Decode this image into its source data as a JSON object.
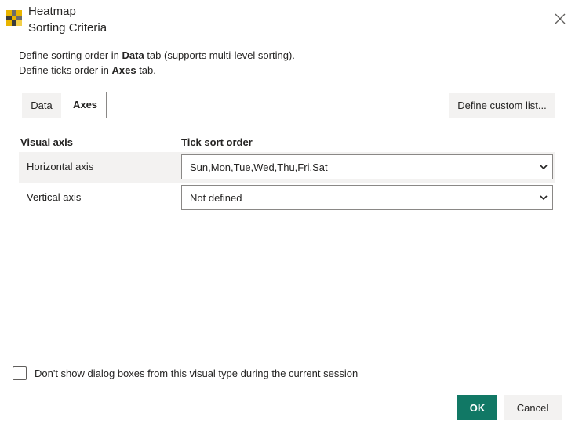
{
  "header": {
    "title": "Heatmap",
    "subtitle": "Sorting Criteria",
    "app_icon": "heatmap-icon",
    "close_icon": "close-icon"
  },
  "instructions": {
    "line1_prefix": "Define sorting order in ",
    "line1_bold": "Data",
    "line1_suffix": " tab (supports multi-level sorting).",
    "line2_prefix": "Define ticks order in ",
    "line2_bold": "Axes",
    "line2_suffix": " tab."
  },
  "tabs": [
    {
      "label": "Data",
      "active": false
    },
    {
      "label": "Axes",
      "active": true
    }
  ],
  "custom_list_button": "Define custom list...",
  "table": {
    "headers": {
      "visual_axis": "Visual axis",
      "tick_sort_order": "Tick sort order"
    },
    "rows": [
      {
        "label": "Horizontal axis",
        "value": "Sun,Mon,Tue,Wed,Thu,Fri,Sat"
      },
      {
        "label": "Vertical axis",
        "value": "Not defined"
      }
    ]
  },
  "footer": {
    "checkbox_label": "Don't show dialog boxes from this visual type during the current session",
    "checkbox_checked": false,
    "ok_label": "OK",
    "cancel_label": "Cancel"
  },
  "colors": {
    "ok_button": "#117865",
    "secondary_button": "#f3f2f1"
  }
}
